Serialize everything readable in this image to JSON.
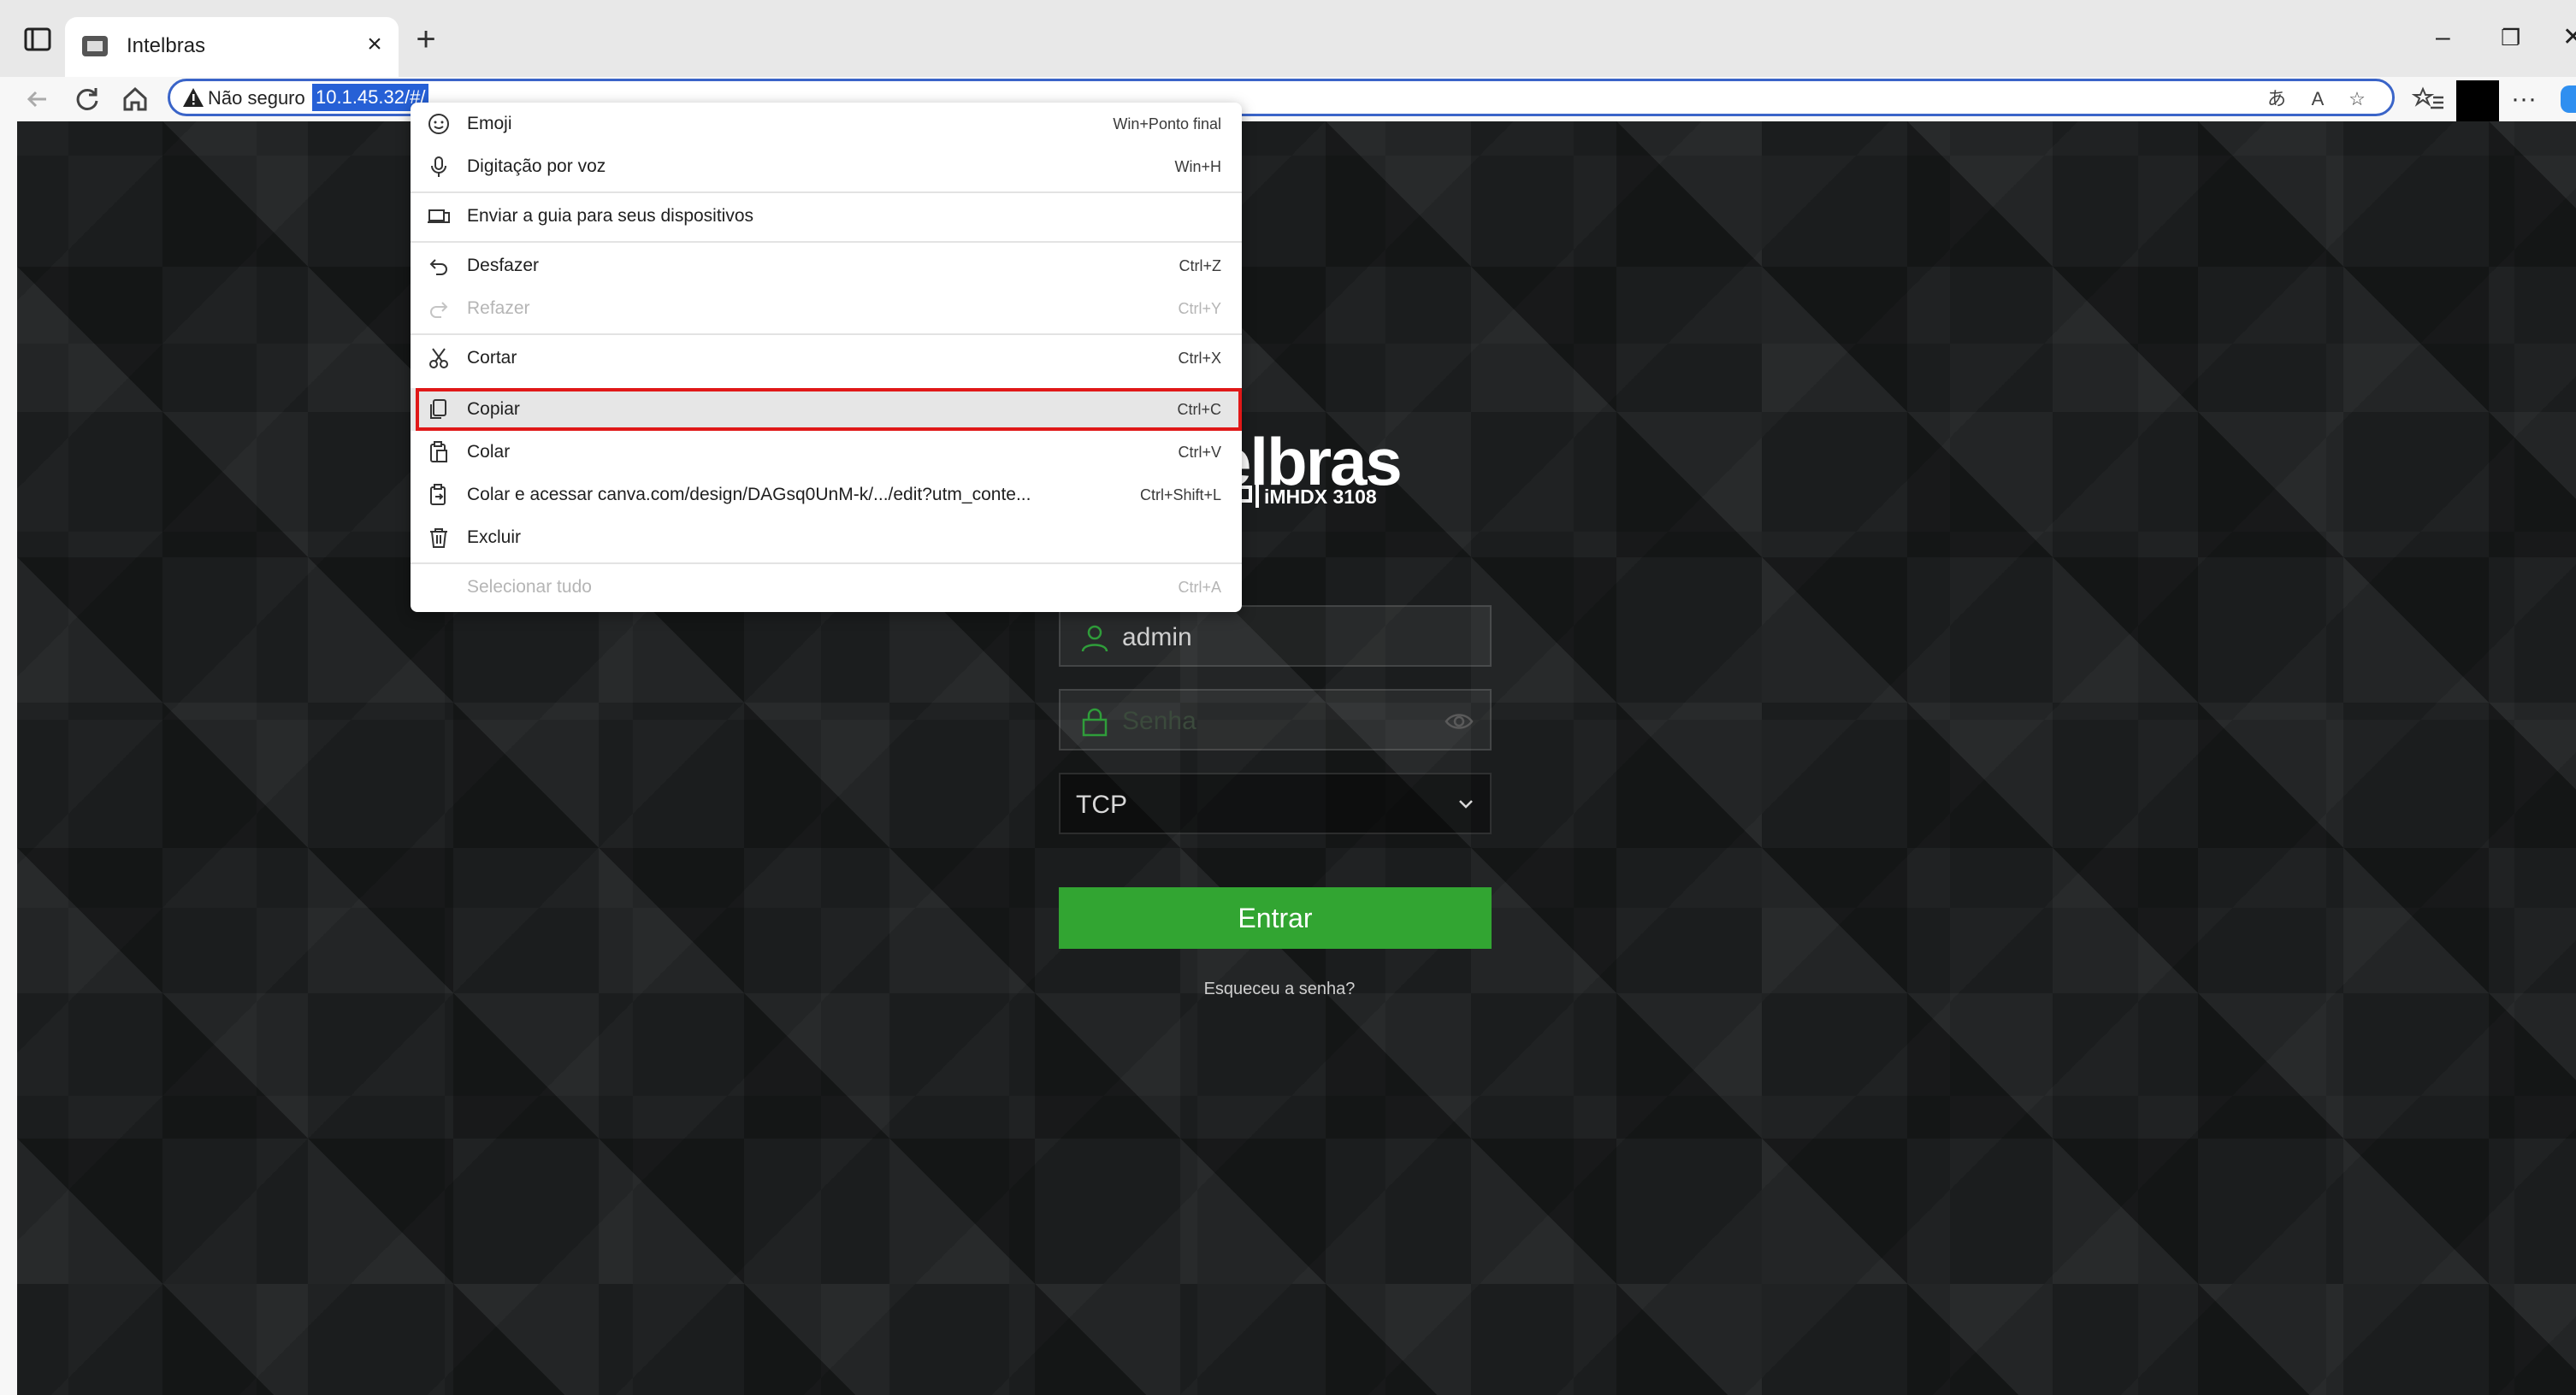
{
  "browser": {
    "tab_title": "Intelbras",
    "address": {
      "security_label": "Não seguro",
      "url": "10.1.45.32/#/"
    },
    "window_controls": [
      "minimize-icon",
      "restore-icon",
      "close-icon"
    ]
  },
  "login": {
    "brand": "elbras",
    "model": "iMHDX 3108",
    "username_value": "admin",
    "password_placeholder": "Senha",
    "protocol_value": "TCP",
    "login_button": "Entrar",
    "forgot_password": "Esqueceu a senha?",
    "accent_color": "#32a532"
  },
  "context_menu": {
    "items": [
      {
        "label": "Emoji",
        "shortcut": "Win+Ponto final",
        "icon": "emoji-icon",
        "enabled": true
      },
      {
        "label": "Digitação por voz",
        "shortcut": "Win+H",
        "icon": "microphone-icon",
        "enabled": true
      },
      {
        "label": "Enviar a guia para seus dispositivos",
        "shortcut": "",
        "icon": "send-to-devices-icon",
        "enabled": true
      },
      {
        "label": "Desfazer",
        "shortcut": "Ctrl+Z",
        "icon": "undo-icon",
        "enabled": true
      },
      {
        "label": "Refazer",
        "shortcut": "Ctrl+Y",
        "icon": "redo-icon",
        "enabled": false
      },
      {
        "label": "Cortar",
        "shortcut": "Ctrl+X",
        "icon": "scissors-icon",
        "enabled": true
      },
      {
        "label": "Copiar",
        "shortcut": "Ctrl+C",
        "icon": "copy-icon",
        "enabled": true,
        "highlighted": true
      },
      {
        "label": "Colar",
        "shortcut": "Ctrl+V",
        "icon": "paste-icon",
        "enabled": true
      },
      {
        "label": "Colar e acessar canva.com/design/DAGsq0UnM-k/.../edit?utm_conte...",
        "shortcut": "Ctrl+Shift+L",
        "icon": "paste-go-icon",
        "enabled": true
      },
      {
        "label": "Excluir",
        "shortcut": "",
        "icon": "trash-icon",
        "enabled": true
      },
      {
        "label": "Selecionar tudo",
        "shortcut": "Ctrl+A",
        "icon": "",
        "enabled": false
      }
    ],
    "highlight_color": "#e01818"
  }
}
